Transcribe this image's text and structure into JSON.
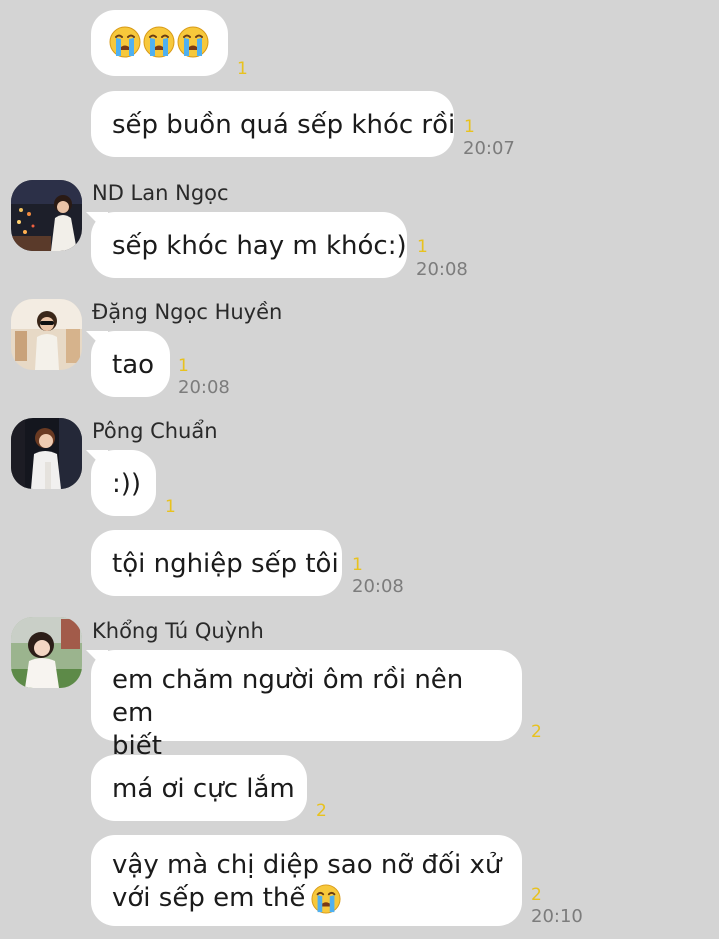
{
  "colors": {
    "background": "#d4d4d4",
    "bubble": "#ffffff",
    "read_count": "#e8c21e",
    "timestamp": "#7c7c7c"
  },
  "messages": [
    {
      "text": "",
      "emoji": [
        "crying-face",
        "crying-face",
        "crying-face"
      ],
      "read_count": "1"
    },
    {
      "text": "sếp buồn quá sếp khóc rồi",
      "read_count": "1",
      "time": "20:07"
    },
    {
      "sender": "ND Lan Ngọc",
      "text": "sếp khóc hay m khóc:)",
      "read_count": "1",
      "time": "20:08"
    },
    {
      "sender": "Đặng Ngọc Huyền",
      "text": "tao",
      "read_count": "1",
      "time": "20:08"
    },
    {
      "sender": "Pông Chuẩn",
      "text": ":))",
      "read_count": "1"
    },
    {
      "text": "tội nghiệp sếp tôi",
      "read_count": "1",
      "time": "20:08"
    },
    {
      "sender": "Khổng Tú Quỳnh",
      "line1": "em chăm người ôm rồi nên em",
      "line2": "biết",
      "read_count": "2"
    },
    {
      "text": "má ơi cực lắm",
      "read_count": "2"
    },
    {
      "line1": "vậy mà chị diệp sao nỡ đối xử",
      "line2": "với sếp em thế",
      "emoji": [
        "crying-face"
      ],
      "read_count": "2",
      "time": "20:10"
    }
  ]
}
